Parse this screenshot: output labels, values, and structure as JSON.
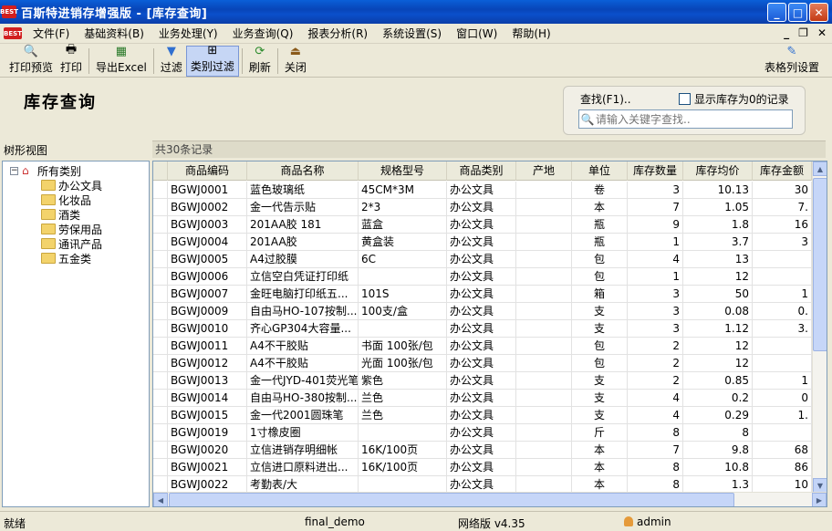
{
  "window": {
    "title": "百斯特进销存增强版 - [库存查询]",
    "app_icon": "BEST"
  },
  "menu": {
    "items": [
      "文件(F)",
      "基础资料(B)",
      "业务处理(Y)",
      "业务查询(Q)",
      "报表分析(R)",
      "系统设置(S)",
      "窗口(W)",
      "帮助(H)"
    ]
  },
  "toolbar": {
    "print_preview": "打印预览",
    "print": "打印",
    "export_excel": "导出Excel",
    "filter": "过滤",
    "category_filter": "类别过滤",
    "refresh": "刷新",
    "close": "关闭",
    "table_column_settings": "表格列设置"
  },
  "page": {
    "title": "库存查询"
  },
  "search": {
    "label": "查找(F1)..",
    "show_zero_label": "显示库存为0的记录",
    "placeholder": "请输入关键字查找.."
  },
  "tree": {
    "header": "树形视图",
    "root": "所有类别",
    "children": [
      "办公文具",
      "化妆品",
      "酒类",
      "劳保用品",
      "通讯产品",
      "五金类"
    ]
  },
  "record_count": "共30条记录",
  "table": {
    "columns": [
      "商品编码",
      "商品名称",
      "规格型号",
      "商品类别",
      "产地",
      "单位",
      "库存数量",
      "库存均价",
      "库存金额"
    ],
    "rows": [
      [
        "BGWJ0001",
        "蓝色玻璃纸",
        "45CM*3M",
        "办公文具",
        "",
        "卷",
        "3",
        "10.13",
        "30"
      ],
      [
        "BGWJ0002",
        "金一代告示贴",
        "2*3",
        "办公文具",
        "",
        "本",
        "7",
        "1.05",
        "7."
      ],
      [
        "BGWJ0003",
        "201AA胶 181",
        "蓝盒",
        "办公文具",
        "",
        "瓶",
        "9",
        "1.8",
        "16"
      ],
      [
        "BGWJ0004",
        "201AA胶",
        "黄盒装",
        "办公文具",
        "",
        "瓶",
        "1",
        "3.7",
        "3"
      ],
      [
        "BGWJ0005",
        "A4过胶膜",
        "6C",
        "办公文具",
        "",
        "包",
        "4",
        "13",
        ""
      ],
      [
        "BGWJ0006",
        "立信空白凭证打印纸",
        "",
        "办公文具",
        "",
        "包",
        "1",
        "12",
        ""
      ],
      [
        "BGWJ0007",
        "金旺电脑打印纸五...",
        "101S",
        "办公文具",
        "",
        "箱",
        "3",
        "50",
        "1"
      ],
      [
        "BGWJ0009",
        "自由马HO-107按制...",
        "100支/盒",
        "办公文具",
        "",
        "支",
        "3",
        "0.08",
        "0."
      ],
      [
        "BGWJ0010",
        "齐心GP304大容量...",
        "",
        "办公文具",
        "",
        "支",
        "3",
        "1.12",
        "3."
      ],
      [
        "BGWJ0011",
        "A4不干胶贴",
        "书面 100张/包",
        "办公文具",
        "",
        "包",
        "2",
        "12",
        ""
      ],
      [
        "BGWJ0012",
        "A4不干胶贴",
        "光面 100张/包",
        "办公文具",
        "",
        "包",
        "2",
        "12",
        ""
      ],
      [
        "BGWJ0013",
        "金一代JYD-401荧光笔",
        "紫色",
        "办公文具",
        "",
        "支",
        "2",
        "0.85",
        "1"
      ],
      [
        "BGWJ0014",
        "自由马HO-380按制...",
        "兰色",
        "办公文具",
        "",
        "支",
        "4",
        "0.2",
        "0"
      ],
      [
        "BGWJ0015",
        "金一代2001圆珠笔",
        "兰色",
        "办公文具",
        "",
        "支",
        "4",
        "0.29",
        "1."
      ],
      [
        "BGWJ0019",
        "1寸橡皮圈",
        "",
        "办公文具",
        "",
        "斤",
        "8",
        "8",
        ""
      ],
      [
        "BGWJ0020",
        "立信进销存明细帐",
        "16K/100页",
        "办公文具",
        "",
        "本",
        "7",
        "9.8",
        "68"
      ],
      [
        "BGWJ0021",
        "立信进口原料进出...",
        "16K/100页",
        "办公文具",
        "",
        "本",
        "8",
        "10.8",
        "86"
      ],
      [
        "BGWJ0022",
        "考勤表/大",
        "",
        "办公文具",
        "",
        "本",
        "8",
        "1.3",
        "10"
      ]
    ]
  },
  "status": {
    "ready": "就绪",
    "database": "final_demo",
    "edition": "网络版 v4.35",
    "user": "admin"
  }
}
